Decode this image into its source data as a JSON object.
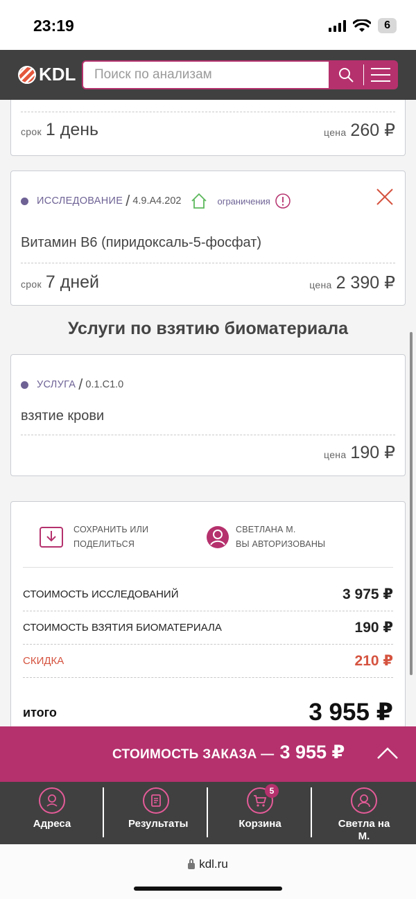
{
  "status_bar": {
    "time": "23:19",
    "battery": "6"
  },
  "header": {
    "logo_text": "KDL",
    "search_placeholder": "Поиск по анализам"
  },
  "cards": [
    {
      "term_label": "срок",
      "term_value": "1 день",
      "price_label": "цена",
      "price_value": "260 ₽"
    },
    {
      "type": "ИССЛЕДОВАНИЕ",
      "code": "4.9.A4.202",
      "restrictions_label": "ограничения",
      "title": "Витамин B6 (пиридоксаль-5-фосфат)",
      "term_label": "срок",
      "term_value": "7 дней",
      "price_label": "цена",
      "price_value": "2 390 ₽"
    }
  ],
  "services_heading": "Услуги по взятию биоматериала",
  "service_card": {
    "type": "УСЛУГА",
    "code": "0.1.C1.0",
    "title": "взятие крови",
    "price_label": "цена",
    "price_value": "190 ₽"
  },
  "summary": {
    "save_share_line1": "СОХРАНИТЬ ИЛИ",
    "save_share_line2": "ПОДЕЛИТЬСЯ",
    "user_name": "СВЕТЛАНА М.",
    "auth_status": "ВЫ АВТОРИЗОВАНЫ",
    "rows": [
      {
        "label": "СТОИМОСТЬ ИССЛЕДОВАНИЙ",
        "value": "3 975 ₽"
      },
      {
        "label": "СТОИМОСТЬ ВЗЯТИЯ БИОМАТЕРИАЛА",
        "value": "190 ₽"
      },
      {
        "label": "СКИДКА",
        "value": "210 ₽"
      }
    ],
    "total_label": "итого",
    "total_value": "3 955 ₽"
  },
  "order_bar": {
    "label": "СТОИМОСТЬ ЗАКАЗА —",
    "amount": "3 955 ₽"
  },
  "bottom_nav": [
    {
      "label": "Адреса",
      "icon": "location-icon"
    },
    {
      "label": "Результаты",
      "icon": "document-icon"
    },
    {
      "label": "Корзина",
      "icon": "cart-icon",
      "badge": "5"
    },
    {
      "label": "Светла на М.",
      "icon": "user-icon"
    }
  ],
  "browser": {
    "url": "kdl.ru"
  },
  "colors": {
    "brand": "#b5316d",
    "header_bg": "#404040",
    "accent_purple": "#6e6295",
    "discount": "#d5533f",
    "house_green": "#5cb85c"
  }
}
